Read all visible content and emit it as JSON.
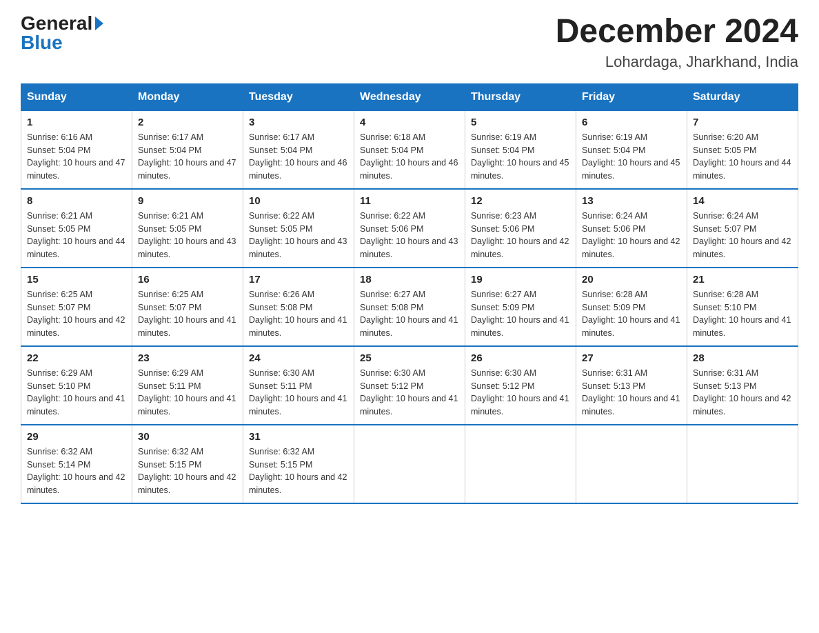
{
  "logo": {
    "general": "General",
    "blue": "Blue"
  },
  "title": "December 2024",
  "subtitle": "Lohardaga, Jharkhand, India",
  "weekdays": [
    "Sunday",
    "Monday",
    "Tuesday",
    "Wednesday",
    "Thursday",
    "Friday",
    "Saturday"
  ],
  "weeks": [
    [
      {
        "day": "1",
        "sunrise": "6:16 AM",
        "sunset": "5:04 PM",
        "daylight": "10 hours and 47 minutes."
      },
      {
        "day": "2",
        "sunrise": "6:17 AM",
        "sunset": "5:04 PM",
        "daylight": "10 hours and 47 minutes."
      },
      {
        "day": "3",
        "sunrise": "6:17 AM",
        "sunset": "5:04 PM",
        "daylight": "10 hours and 46 minutes."
      },
      {
        "day": "4",
        "sunrise": "6:18 AM",
        "sunset": "5:04 PM",
        "daylight": "10 hours and 46 minutes."
      },
      {
        "day": "5",
        "sunrise": "6:19 AM",
        "sunset": "5:04 PM",
        "daylight": "10 hours and 45 minutes."
      },
      {
        "day": "6",
        "sunrise": "6:19 AM",
        "sunset": "5:04 PM",
        "daylight": "10 hours and 45 minutes."
      },
      {
        "day": "7",
        "sunrise": "6:20 AM",
        "sunset": "5:05 PM",
        "daylight": "10 hours and 44 minutes."
      }
    ],
    [
      {
        "day": "8",
        "sunrise": "6:21 AM",
        "sunset": "5:05 PM",
        "daylight": "10 hours and 44 minutes."
      },
      {
        "day": "9",
        "sunrise": "6:21 AM",
        "sunset": "5:05 PM",
        "daylight": "10 hours and 43 minutes."
      },
      {
        "day": "10",
        "sunrise": "6:22 AM",
        "sunset": "5:05 PM",
        "daylight": "10 hours and 43 minutes."
      },
      {
        "day": "11",
        "sunrise": "6:22 AM",
        "sunset": "5:06 PM",
        "daylight": "10 hours and 43 minutes."
      },
      {
        "day": "12",
        "sunrise": "6:23 AM",
        "sunset": "5:06 PM",
        "daylight": "10 hours and 42 minutes."
      },
      {
        "day": "13",
        "sunrise": "6:24 AM",
        "sunset": "5:06 PM",
        "daylight": "10 hours and 42 minutes."
      },
      {
        "day": "14",
        "sunrise": "6:24 AM",
        "sunset": "5:07 PM",
        "daylight": "10 hours and 42 minutes."
      }
    ],
    [
      {
        "day": "15",
        "sunrise": "6:25 AM",
        "sunset": "5:07 PM",
        "daylight": "10 hours and 42 minutes."
      },
      {
        "day": "16",
        "sunrise": "6:25 AM",
        "sunset": "5:07 PM",
        "daylight": "10 hours and 41 minutes."
      },
      {
        "day": "17",
        "sunrise": "6:26 AM",
        "sunset": "5:08 PM",
        "daylight": "10 hours and 41 minutes."
      },
      {
        "day": "18",
        "sunrise": "6:27 AM",
        "sunset": "5:08 PM",
        "daylight": "10 hours and 41 minutes."
      },
      {
        "day": "19",
        "sunrise": "6:27 AM",
        "sunset": "5:09 PM",
        "daylight": "10 hours and 41 minutes."
      },
      {
        "day": "20",
        "sunrise": "6:28 AM",
        "sunset": "5:09 PM",
        "daylight": "10 hours and 41 minutes."
      },
      {
        "day": "21",
        "sunrise": "6:28 AM",
        "sunset": "5:10 PM",
        "daylight": "10 hours and 41 minutes."
      }
    ],
    [
      {
        "day": "22",
        "sunrise": "6:29 AM",
        "sunset": "5:10 PM",
        "daylight": "10 hours and 41 minutes."
      },
      {
        "day": "23",
        "sunrise": "6:29 AM",
        "sunset": "5:11 PM",
        "daylight": "10 hours and 41 minutes."
      },
      {
        "day": "24",
        "sunrise": "6:30 AM",
        "sunset": "5:11 PM",
        "daylight": "10 hours and 41 minutes."
      },
      {
        "day": "25",
        "sunrise": "6:30 AM",
        "sunset": "5:12 PM",
        "daylight": "10 hours and 41 minutes."
      },
      {
        "day": "26",
        "sunrise": "6:30 AM",
        "sunset": "5:12 PM",
        "daylight": "10 hours and 41 minutes."
      },
      {
        "day": "27",
        "sunrise": "6:31 AM",
        "sunset": "5:13 PM",
        "daylight": "10 hours and 41 minutes."
      },
      {
        "day": "28",
        "sunrise": "6:31 AM",
        "sunset": "5:13 PM",
        "daylight": "10 hours and 42 minutes."
      }
    ],
    [
      {
        "day": "29",
        "sunrise": "6:32 AM",
        "sunset": "5:14 PM",
        "daylight": "10 hours and 42 minutes."
      },
      {
        "day": "30",
        "sunrise": "6:32 AM",
        "sunset": "5:15 PM",
        "daylight": "10 hours and 42 minutes."
      },
      {
        "day": "31",
        "sunrise": "6:32 AM",
        "sunset": "5:15 PM",
        "daylight": "10 hours and 42 minutes."
      },
      null,
      null,
      null,
      null
    ]
  ]
}
